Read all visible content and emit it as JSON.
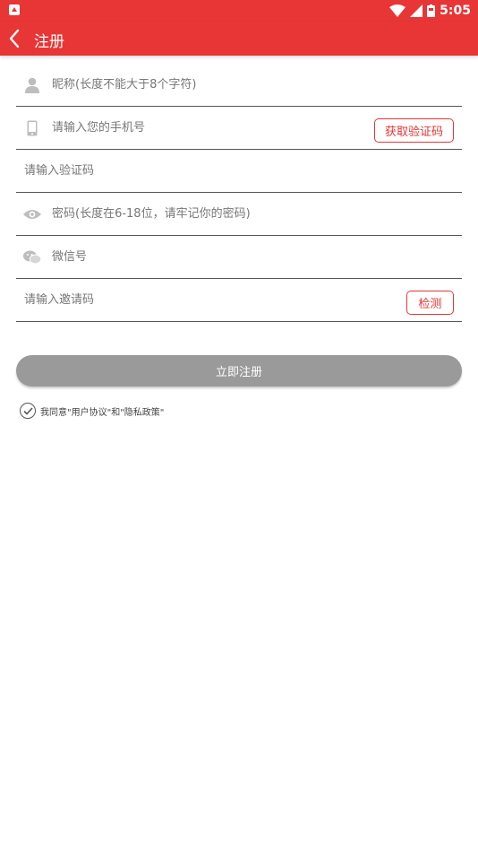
{
  "status_bar": {
    "time": "5:05"
  },
  "header": {
    "title": "注册"
  },
  "form": {
    "nickname": {
      "placeholder": "昵称(长度不能大于8个字符)",
      "icon": "person-icon"
    },
    "phone": {
      "placeholder": "请输入您的手机号",
      "icon": "phone-icon",
      "button": "获取验证码"
    },
    "code": {
      "placeholder": "请输入验证码"
    },
    "password": {
      "placeholder": "密码(长度在6-18位，请牢记你的密码)",
      "icon": "eye-icon"
    },
    "wechat": {
      "placeholder": "微信号",
      "icon": "wechat-icon"
    },
    "invite": {
      "placeholder": "请输入邀请码",
      "button": "检测"
    }
  },
  "submit_label": "立即注册",
  "agreement": "我同意\"用户协议\"和\"隐私政策\"",
  "colors": {
    "brand": "#e83535",
    "button_disabled": "#9a9a9a"
  }
}
